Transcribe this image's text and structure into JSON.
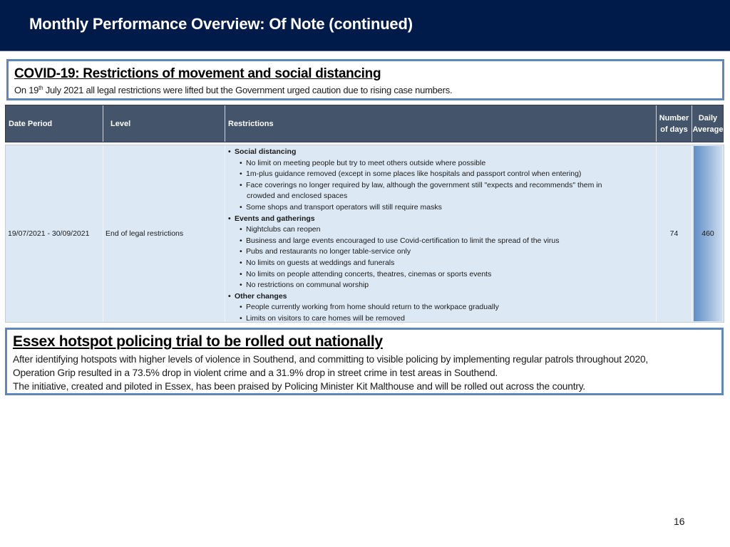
{
  "header": {
    "title": "Monthly Performance Overview: Of Note (continued)"
  },
  "colors": {
    "header_bg": "#001a4a",
    "box_border": "#5f87b9",
    "table_header_bg": "#44546a",
    "table_row_bg": "#dce9f5",
    "data_bar": "#5e8ec7"
  },
  "covid_note": {
    "title": "COVID-19: Restrictions of movement and social distancing",
    "text_prefix": "On 19",
    "text_sup": "th",
    "text_suffix": " July 2021 all legal restrictions were lifted but the Government urged caution due to rising case numbers."
  },
  "table": {
    "headers": {
      "date_period": "Date Period",
      "level": "Level",
      "restrictions": "Restrictions",
      "number_of_days_line1": "Number",
      "number_of_days_line2": "of days",
      "daily_average_line1": "Daily",
      "daily_average_line2": "Average"
    },
    "rows": [
      {
        "date_period": "19/07/2021 - 30/09/2021",
        "level": "End of legal restrictions",
        "number_of_days": "74",
        "daily_average": "460",
        "restrictions": [
          {
            "type": "head",
            "text": "Social distancing"
          },
          {
            "type": "item",
            "text": "No limit on meeting people but try to meet others outside where possible"
          },
          {
            "type": "item",
            "text": "1m-plus guidance removed (except in some places like hospitals and passport control when entering)"
          },
          {
            "type": "item",
            "text": "Face coverings no longer required by law, although the government still \"expects and recommends\" them in"
          },
          {
            "type": "cont",
            "text": "crowded and enclosed spaces"
          },
          {
            "type": "item",
            "text": "Some shops and transport operators will still require masks"
          },
          {
            "type": "head",
            "text": "Events and gatherings"
          },
          {
            "type": "item",
            "text": "Nightclubs can reopen"
          },
          {
            "type": "item",
            "text": "Business and large events encouraged to use Covid-certification to limit the spread of the virus"
          },
          {
            "type": "item",
            "text": "Pubs and restaurants no longer table-service only"
          },
          {
            "type": "item",
            "text": "No limits on guests at weddings and funerals"
          },
          {
            "type": "item",
            "text": "No limits on people attending concerts, theatres, cinemas or sports events"
          },
          {
            "type": "item",
            "text": "No restrictions on communal worship"
          },
          {
            "type": "head",
            "text": "Other changes"
          },
          {
            "type": "item",
            "text": "People currently working from home should return to the workpace gradually"
          },
          {
            "type": "item",
            "text": "Limits on visitors to care homes will be removed"
          }
        ]
      }
    ]
  },
  "essex_note": {
    "title": "Essex hotspot policing trial to be rolled out nationally",
    "lines": [
      "After identifying hotspots with higher levels of violence in Southend, and committing to visible policing by implementing regular patrols throughout 2020,",
      "Operation Grip resulted in a 73.5% drop in violent crime and a 31.9% drop in street crime in test areas in Southend.",
      "The initiative, created and piloted in Essex, has been praised by Policing Minister Kit Malthouse and will be rolled out across the country."
    ]
  },
  "footer": {
    "page_number": "16"
  }
}
